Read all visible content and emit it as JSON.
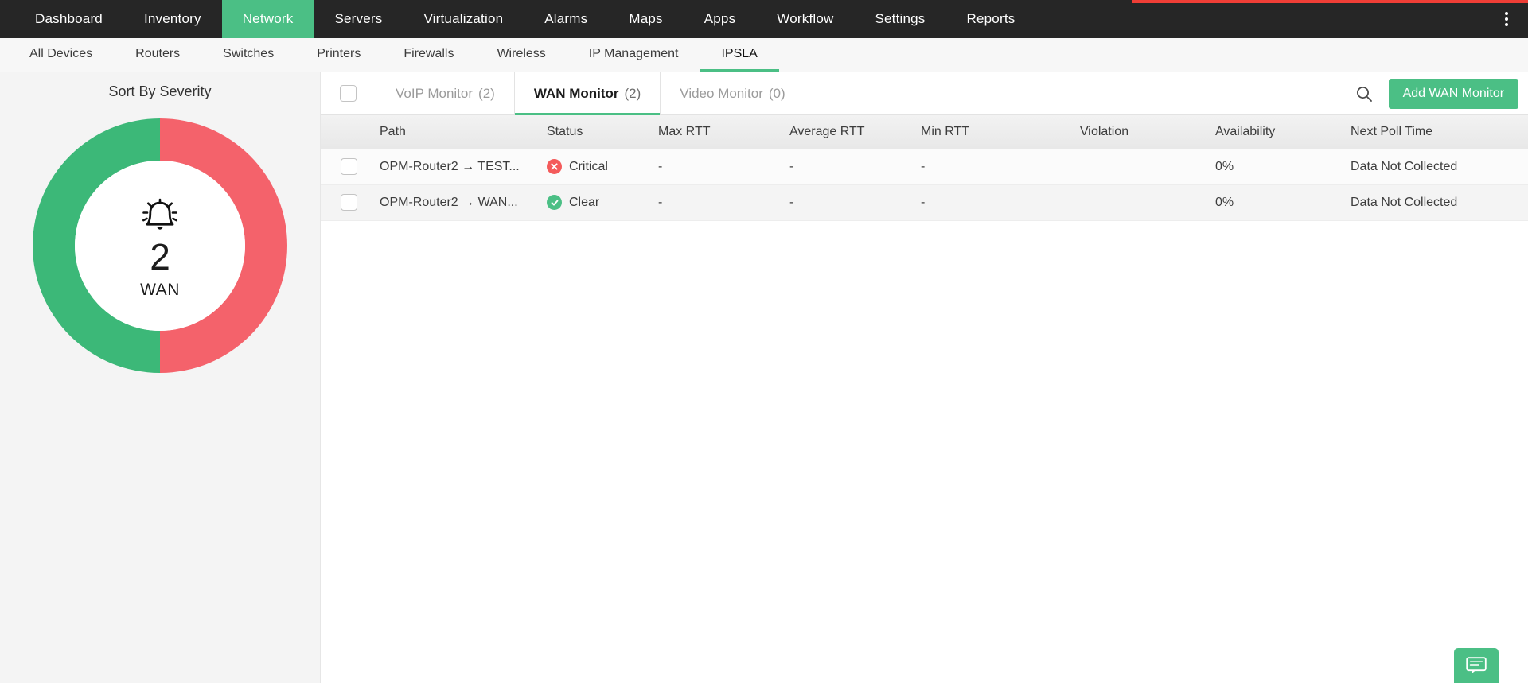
{
  "top_progress": {
    "color": "#ef3e36",
    "visible": true
  },
  "main_nav": {
    "active": "Network",
    "items": [
      {
        "label": "Dashboard"
      },
      {
        "label": "Inventory"
      },
      {
        "label": "Network"
      },
      {
        "label": "Servers"
      },
      {
        "label": "Virtualization"
      },
      {
        "label": "Alarms"
      },
      {
        "label": "Maps"
      },
      {
        "label": "Apps"
      },
      {
        "label": "Workflow"
      },
      {
        "label": "Settings"
      },
      {
        "label": "Reports"
      }
    ],
    "overflow_icon": "kebab-menu-icon"
  },
  "sub_nav": {
    "active": "IPSLA",
    "items": [
      {
        "label": "All Devices"
      },
      {
        "label": "Routers"
      },
      {
        "label": "Switches"
      },
      {
        "label": "Printers"
      },
      {
        "label": "Firewalls"
      },
      {
        "label": "Wireless"
      },
      {
        "label": "IP Management"
      },
      {
        "label": "IPSLA"
      }
    ]
  },
  "left_panel": {
    "title": "Sort By Severity",
    "center_icon": "alarm-bell-icon",
    "count": "2",
    "label": "WAN"
  },
  "chart_data": {
    "type": "pie",
    "title": "Sort By Severity",
    "categories": [
      "Clear",
      "Critical"
    ],
    "values": [
      1,
      1
    ],
    "colors": [
      "#3cb878",
      "#f4626b"
    ],
    "total": 2,
    "center_value": "2",
    "center_label": "WAN",
    "donut": true,
    "legend": "none"
  },
  "tabs": {
    "select_all_icon": "checkbox-icon",
    "items": [
      {
        "name": "VoIP Monitor",
        "count": "(2)",
        "active": false
      },
      {
        "name": "WAN Monitor",
        "count": "(2)",
        "active": true
      },
      {
        "name": "Video Monitor",
        "count": "(0)",
        "active": false
      }
    ],
    "search_icon": "search-icon",
    "add_button": "Add WAN Monitor"
  },
  "table": {
    "columns": [
      "Path",
      "Status",
      "Max RTT",
      "Average RTT",
      "Min RTT",
      "Violation",
      "Availability",
      "Next Poll Time"
    ],
    "rows": [
      {
        "path": "OPM-Router2 → TEST...",
        "status": "Critical",
        "status_icon": "error-circle-icon",
        "max_rtt": "-",
        "average_rtt": "-",
        "min_rtt": "-",
        "violation": "",
        "availability": "0%",
        "next_poll_time": "Data Not Collected"
      },
      {
        "path": "OPM-Router2 → WAN...",
        "status": "Clear",
        "status_icon": "check-circle-icon",
        "max_rtt": "-",
        "average_rtt": "-",
        "min_rtt": "-",
        "violation": "",
        "availability": "0%",
        "next_poll_time": "Data Not Collected"
      }
    ]
  },
  "fab": {
    "icon": "chat-support-icon"
  }
}
